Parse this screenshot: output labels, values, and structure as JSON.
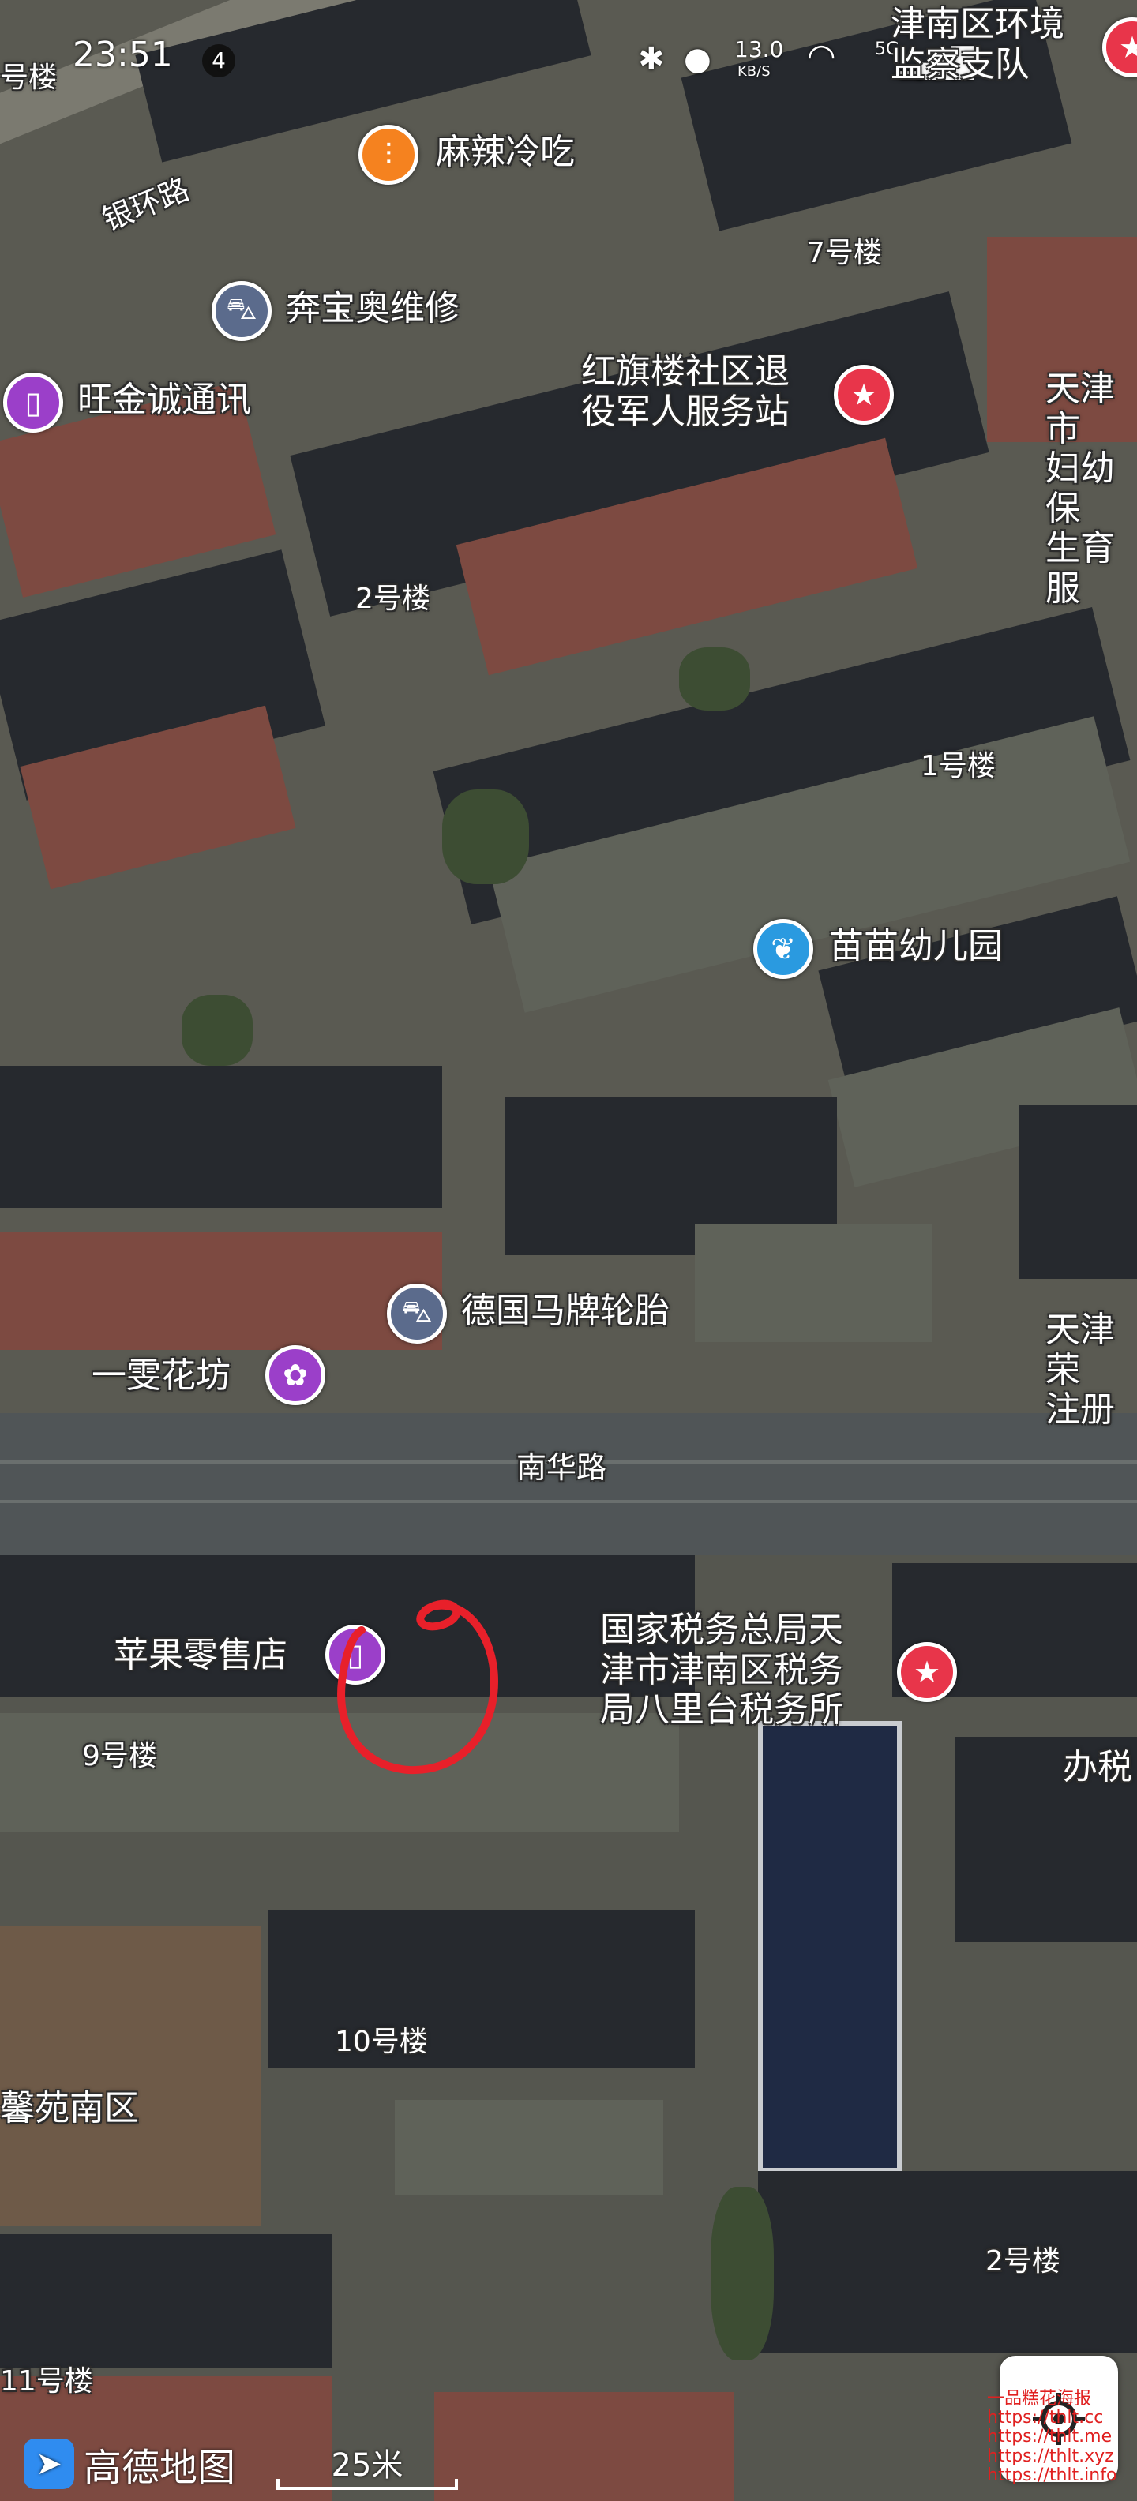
{
  "status_bar": {
    "time": "23:51",
    "notification_count": "4",
    "net_speed": "13.0",
    "net_speed_unit": "KB/S",
    "network": "5G"
  },
  "road_labels": {
    "yinhuan_road": "银环路",
    "nanhua_road": "南华路"
  },
  "building_labels": {
    "b_hao_lou": "号楼",
    "b7": "7号楼",
    "b2_top": "2号楼",
    "b1": "1号楼",
    "b9": "9号楼",
    "b10": "10号楼",
    "b2_bottom": "2号楼",
    "b11": "11号楼",
    "xinyuan": "馨苑南区"
  },
  "pois": {
    "jinnan_env": {
      "label": "津南区环境\n监察支队",
      "icon": "star-icon",
      "color": "#e8354a"
    },
    "mala": {
      "label": "麻辣冷吃",
      "icon": "fork-knife-icon",
      "color": "#f5821f"
    },
    "benbao": {
      "label": "奔宝奥维修",
      "icon": "car-icon",
      "color": "#5b6b8c"
    },
    "wangjincheng": {
      "label": "旺金诚通讯",
      "icon": "phone-icon",
      "color": "#9b3fc9"
    },
    "hongqilou": {
      "label": "红旗楼社区退\n役军人服务站",
      "icon": "star-icon",
      "color": "#e8354a"
    },
    "tianjin_fuyou": {
      "label": "天津市\n妇幼保\n生育服",
      "icon": "",
      "color": ""
    },
    "miaomiao": {
      "label": "苗苗幼儿园",
      "icon": "sprout-icon",
      "color": "#2a9ae0"
    },
    "deguo": {
      "label": "德国马牌轮胎",
      "icon": "car-icon",
      "color": "#5b6b8c"
    },
    "yiwen": {
      "label": "一雯花坊",
      "icon": "flower-icon",
      "color": "#9b3fc9"
    },
    "tianjin_zhuce": {
      "label": "天津荣\n注册",
      "icon": "",
      "color": ""
    },
    "pingguo": {
      "label": "苹果零售店",
      "icon": "phone-icon",
      "color": "#9b3fc9"
    },
    "shuiwu": {
      "label": "国家税务总局天\n津市津南区税务\n局八里台税务所",
      "icon": "star-icon",
      "color": "#e8354a"
    },
    "banshui": {
      "label": "办税",
      "icon": "",
      "color": ""
    }
  },
  "bottom": {
    "logo_text": "高德地图",
    "scale_text": "25米",
    "watermark": "一品糕花海报\nhttps://thlt.cc\nhttps://thlt.me\nhttps://thlt.xyz\nhttps://thlt.info"
  },
  "colors": {
    "annotation_circle": "#e8202a",
    "label_text": "#ffffff"
  }
}
